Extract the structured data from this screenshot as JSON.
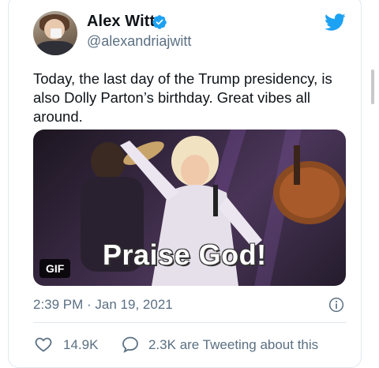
{
  "tweet": {
    "author_name": "Alex Witt",
    "handle": "@alexandriajwitt",
    "text": "Today, the last day of the Trump presidency, is also Dolly Parton’s birthday. Great vibes all around.",
    "media": {
      "badge": "GIF",
      "caption": "Praise God!"
    },
    "timestamp": "2:39 PM · Jan 19, 2021",
    "likes": "14.9K",
    "tweeting_about": "2.3K are Tweeting about this"
  },
  "colors": {
    "brand_blue": "#1da1f2",
    "secondary_text": "#5b7083",
    "primary_text": "#0f1419",
    "divider": "#e1e8ed"
  },
  "icons": {
    "verified": "verified-badge-icon",
    "brand": "twitter-bird-icon",
    "info": "info-icon",
    "like": "heart-icon",
    "reply": "speech-bubble-icon"
  }
}
